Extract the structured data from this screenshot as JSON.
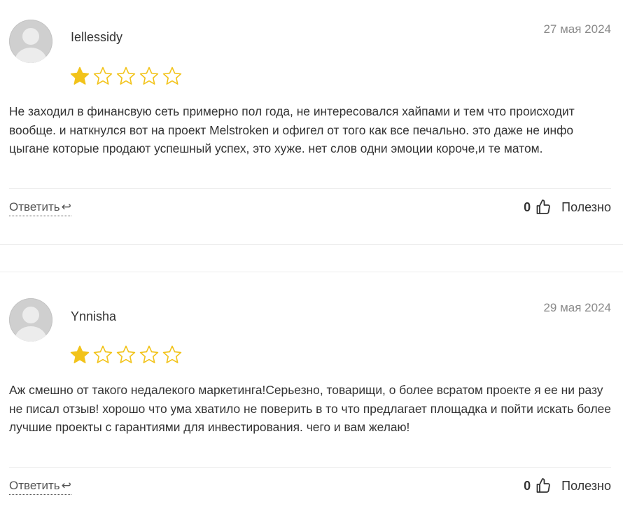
{
  "reviews": [
    {
      "author": "Iellessidy",
      "date": "27 мая 2024",
      "rating": 1,
      "max_rating": 5,
      "text": "Не заходил в финансвую сеть примерно пол года, не интересовался хайпами и тем что происходит вообще. и наткнулся вот на проект Melstroken и офигел от того как все печально. это даже не инфо цыгане которые продают успешный успех, это хуже. нет слов одни эмоции короче,и те матом.",
      "reply_label": "Ответить",
      "helpful_count": "0",
      "helpful_label": "Полезно"
    },
    {
      "author": "Ynnisha",
      "date": "29 мая 2024",
      "rating": 1,
      "max_rating": 5,
      "text": "Аж смешно от такого недалекого маркетинга!Серьезно, товарищи, о более всратом проекте я ее ни разу не писал отзыв! хорошо что ума хватило не поверить в то что предлагает площадка и пойти искать более лучшие проекты с гарантиями для инвестирования. чего и вам желаю!",
      "reply_label": "Ответить",
      "helpful_count": "0",
      "helpful_label": "Полезно"
    }
  ],
  "colors": {
    "star_filled": "#F2C31A",
    "star_outline": "#F2C31A",
    "divider": "#ECECEC",
    "date": "#8A8A8A"
  },
  "icons": {
    "reply": "reply-arrow-icon",
    "helpful": "thumbs-up-icon",
    "star": "star-icon"
  }
}
